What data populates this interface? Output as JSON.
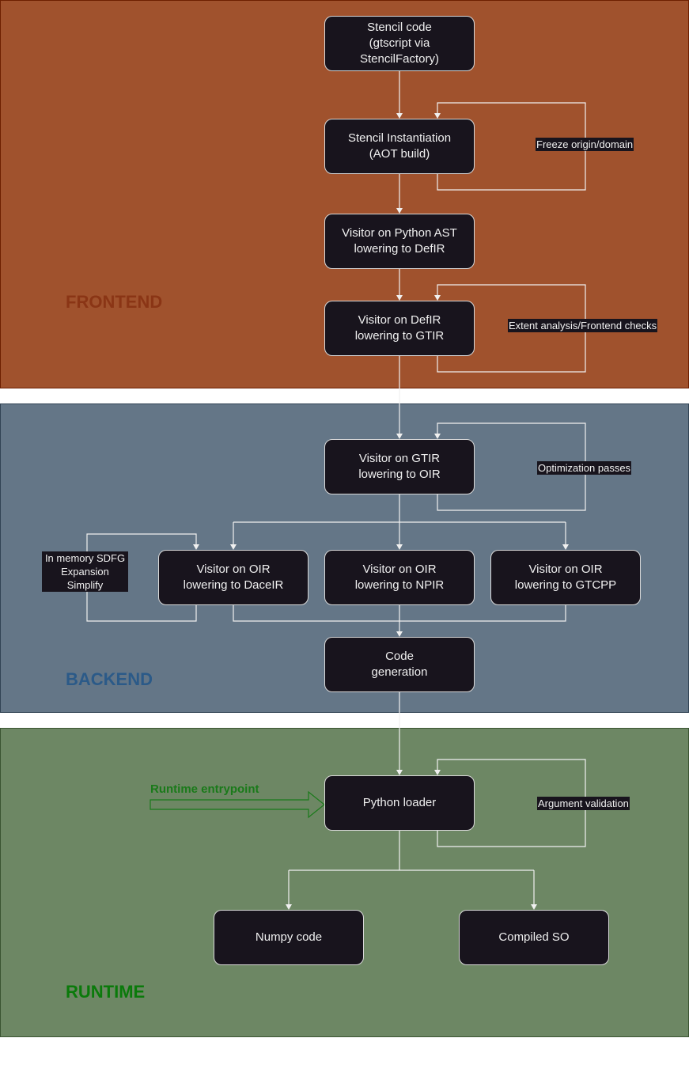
{
  "sections": {
    "frontend": "FRONTEND",
    "backend": "BACKEND",
    "runtime": "RUNTIME"
  },
  "section_colors": {
    "frontend_bg": "#a0522d",
    "backend_bg": "#647687",
    "runtime_bg": "#6d8764",
    "frontend_label": "#8a3515",
    "backend_label": "#2b5a88",
    "runtime_label": "#0a7a0a"
  },
  "nodes": {
    "stencil_code": "Stencil code\n(gtscript via\nStencilFactory)",
    "stencil_instantiation": "Stencil Instantiation\n(AOT build)",
    "python_ast": "Visitor on Python AST\nlowering to DefIR",
    "defir": "Visitor on DefIR\nlowering to GTIR",
    "gtir": "Visitor on GTIR\nlowering to OIR",
    "daceir": "Visitor on OIR\nlowering to DaceIR",
    "npir": "Visitor on OIR\nlowering to NPIR",
    "gtcpp": "Visitor on OIR\nlowering to GTCPP",
    "codegen": "Code\ngeneration",
    "loader": "Python loader",
    "numpy": "Numpy code",
    "compiled": "Compiled SO"
  },
  "loop_labels": {
    "freeze": "Freeze origin/domain",
    "extent": "Extent analysis/Frontend checks",
    "optimization": "Optimization passes",
    "sdfg": "In memory SDFG\nExpansion\nSimplify",
    "argument": "Argument validation"
  },
  "entrypoint": {
    "label": "Runtime entrypoint",
    "color": "#1a7a1a"
  }
}
